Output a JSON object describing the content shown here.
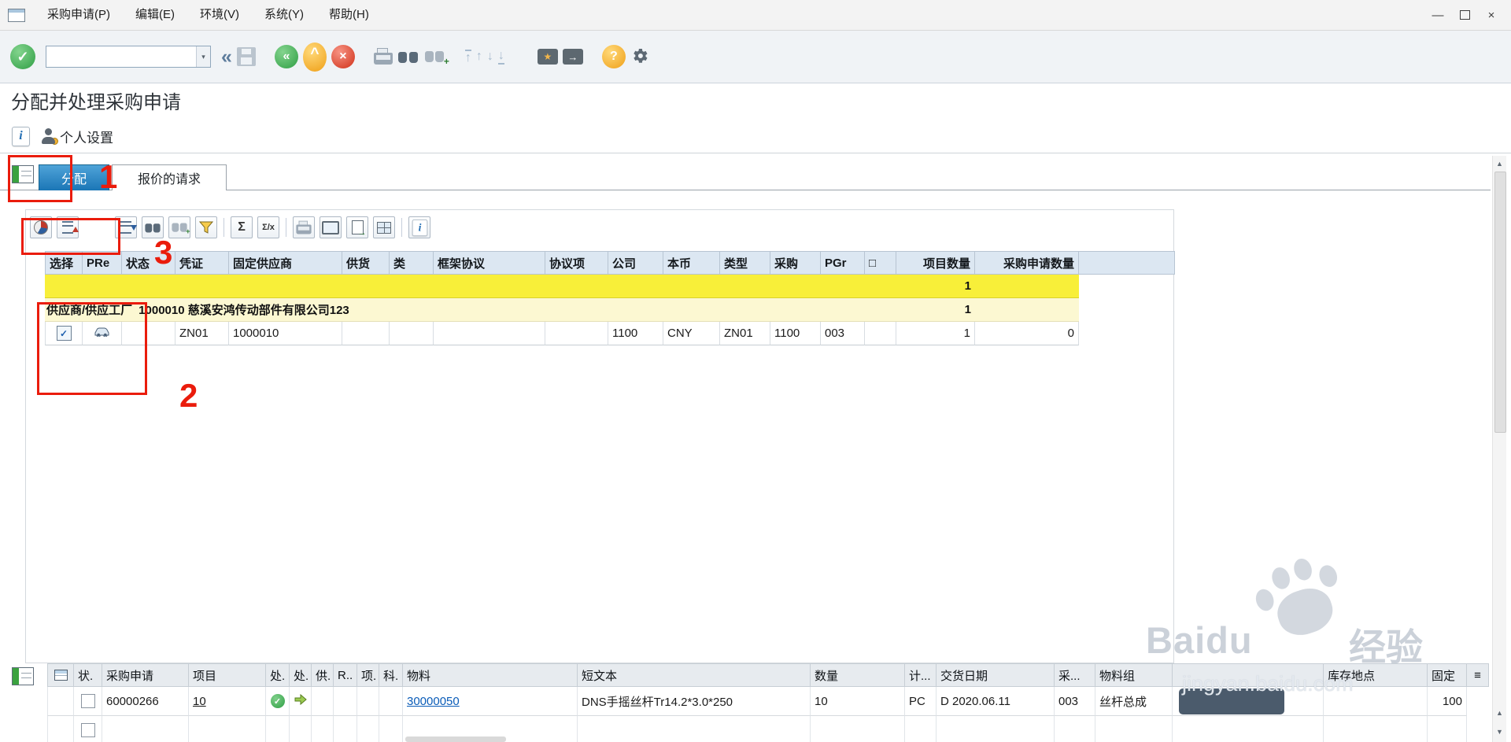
{
  "menu_bar": {
    "items": [
      "采购申请(P)",
      "编辑(E)",
      "环境(V)",
      "系统(Y)",
      "帮助(H)"
    ]
  },
  "window_controls": {
    "minimize": "—",
    "close": "×"
  },
  "command_field": {
    "value": ""
  },
  "title": "分配并处理采购申请",
  "app_toolbar": {
    "personal_settings": "个人设置"
  },
  "tabs": {
    "items": [
      {
        "label": "分配",
        "active": true
      },
      {
        "label": "报价的请求",
        "active": false
      }
    ]
  },
  "annotations": {
    "step1": "1",
    "step2": "2",
    "step3": "3"
  },
  "icons": {
    "enter": "✓",
    "back_double": "«",
    "back": "«",
    "exit": "^",
    "cancel": "×",
    "help": "?",
    "find_plus": "+",
    "sum": "Σ",
    "subtotal": "Σ/x",
    "info": "i",
    "dropdown": "▾",
    "star": "★",
    "arrow": "→",
    "config": "≡",
    "check": "✓",
    "page_up": "↑",
    "page_down": "↓",
    "scroll_up": "▲",
    "scroll_down": "▼",
    "minimize": "—",
    "close": "×"
  },
  "toolbar_icon_names": [
    "enter-icon",
    "command-field",
    "back-double-icon",
    "save-icon",
    "back-icon",
    "exit-icon",
    "cancel-icon",
    "print-icon",
    "find-icon",
    "find-next-icon",
    "first-page-icon",
    "page-up-icon",
    "page-down-icon",
    "last-page-icon",
    "create-shortcut-icon",
    "shortcut-icon",
    "help-icon",
    "customize-icon"
  ],
  "alv_toolbar_icon_names": [
    "chart-icon",
    "sort-asc-icon",
    "sort-desc-icon",
    "find-icon",
    "find-next-icon",
    "filter-icon",
    "sum-icon",
    "subtotal-icon",
    "print-icon",
    "views-icon",
    "export-icon",
    "layout-icon",
    "info-icon"
  ],
  "assignment_grid": {
    "columns": [
      "选择",
      "PRe",
      "状态",
      "凭证",
      "固定供应商",
      "供货",
      "类",
      "框架协议",
      "协议项",
      "公司",
      "本币",
      "类型",
      "采购",
      "PGr",
      "□",
      "项目数量",
      "采购申请数量"
    ],
    "total_row": {
      "item_qty": "1"
    },
    "vendor_row": {
      "label_prefix": "供应商/供应工厂",
      "label_value": "1000010 慈溪安鸿传动部件有限公司123",
      "item_qty": "1"
    },
    "rows": [
      {
        "cells": [
          {
            "type": "checkbox"
          },
          {
            "type": "icon",
            "icon": "car-icon"
          },
          {
            "v": ""
          },
          {
            "v": "ZN01"
          },
          {
            "v": "1000010"
          },
          {
            "v": ""
          },
          {
            "v": ""
          },
          {
            "v": ""
          },
          {
            "v": ""
          },
          {
            "v": "1100"
          },
          {
            "v": "CNY"
          },
          {
            "v": "ZN01"
          },
          {
            "v": "1100"
          },
          {
            "v": "003"
          },
          {
            "v": ""
          },
          {
            "v": "1"
          },
          {
            "v": "0"
          }
        ]
      }
    ]
  },
  "item_grid": {
    "columns": [
      "",
      "状.",
      "采购申请",
      "项目",
      "处.",
      "处.",
      "供.",
      "R..",
      "项.",
      "科.",
      "物料",
      "短文本",
      "数量",
      "计...",
      "交货日期",
      "采...",
      "物料组",
      "",
      "库存地点",
      "固定"
    ],
    "rows": [
      {
        "cells": [
          {},
          {
            "type": "checkbox"
          },
          {
            "v": "60000266"
          },
          {
            "v": "10",
            "type": "underline"
          },
          {
            "type": "icon",
            "icon": "green-check-icon"
          },
          {
            "type": "icon",
            "icon": "green-arrow-icon"
          },
          {},
          {},
          {},
          {},
          {
            "v": "30000050",
            "type": "link"
          },
          {
            "v": "DNS手摇丝杆Tr14.2*3.0*250"
          },
          {
            "v": "10"
          },
          {
            "v": "PC"
          },
          {
            "v": "D 2020.06.11"
          },
          {
            "v": "003"
          },
          {
            "v": "丝杆总成"
          },
          {},
          {},
          {
            "v": "100"
          }
        ]
      },
      {
        "cells": [
          {},
          {
            "type": "checkbox"
          },
          {},
          {},
          {},
          {},
          {},
          {},
          {},
          {},
          {},
          {},
          {},
          {},
          {},
          {},
          {},
          {},
          {},
          {}
        ]
      }
    ]
  },
  "watermark": {
    "brand": "Baidu",
    "brand_suffix": "经验",
    "url": "jingyan.baidu.com"
  }
}
